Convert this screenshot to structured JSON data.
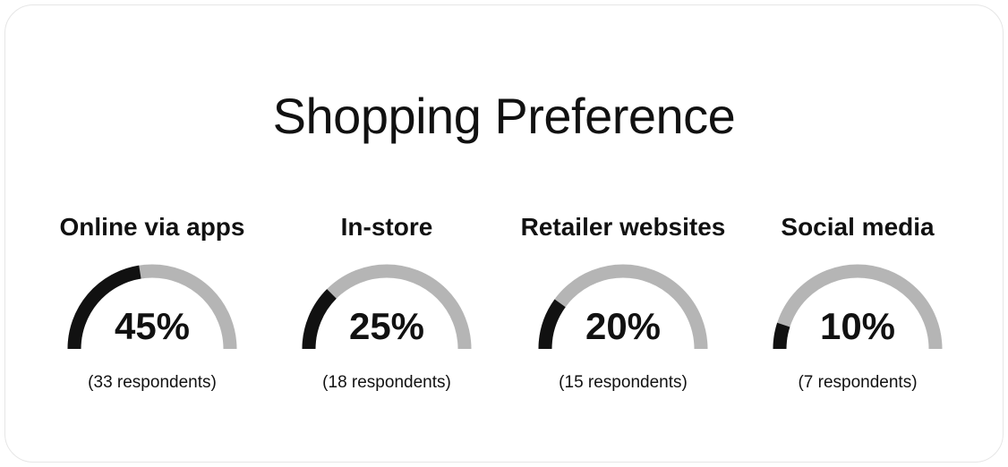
{
  "colors": {
    "filled": "#111111",
    "track": "#b5b5b5",
    "text": "#111111"
  },
  "chart_data": {
    "type": "gauge",
    "title": "Shopping Preference",
    "max": 100,
    "items": [
      {
        "label": "Online via apps",
        "value": 45,
        "value_text": "45%",
        "count_text": "(33 respondents)"
      },
      {
        "label": "In-store",
        "value": 25,
        "value_text": "25%",
        "count_text": "(18 respondents)"
      },
      {
        "label": "Retailer websites",
        "value": 20,
        "value_text": "20%",
        "count_text": "(15 respondents)"
      },
      {
        "label": "Social media",
        "value": 10,
        "value_text": "10%",
        "count_text": "(7 respondents)"
      }
    ]
  }
}
